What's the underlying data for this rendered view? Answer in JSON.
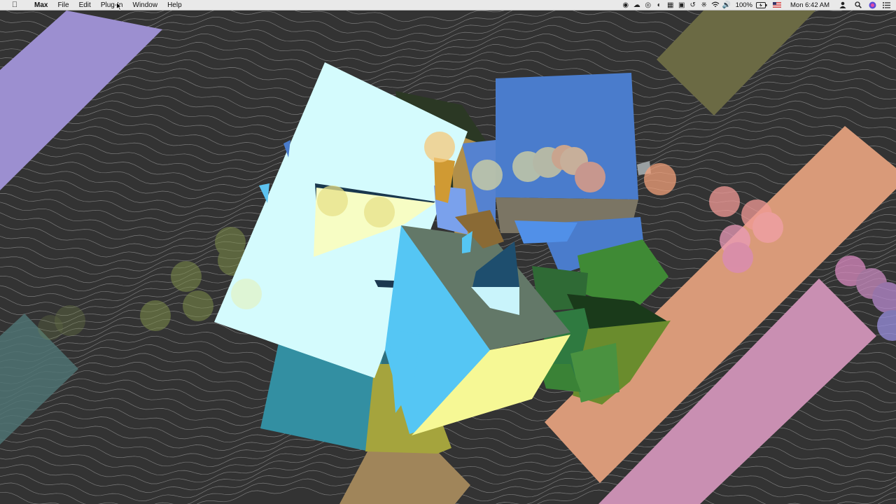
{
  "menubar": {
    "apple_icon": "apple-logo-icon",
    "app_name": "Max",
    "menus": [
      "File",
      "Edit",
      "Plug-In",
      "Window",
      "Help"
    ],
    "status_icons": [
      "record-icon",
      "cloud-icon",
      "cc-icon",
      "sync-icon",
      "grid-icon",
      "screen-icon",
      "time-machine-icon",
      "bluetooth-icon",
      "wifi-icon",
      "volume-icon"
    ],
    "battery_percent": "100%",
    "battery_icon": "battery-charging-icon",
    "input_source_icon": "us-flag-icon",
    "clock": "Mon 6:42 AM",
    "user_icon": "user-icon",
    "spotlight_icon": "search-icon",
    "siri_icon": "siri-icon",
    "notification_icon": "notification-center-icon"
  },
  "scene": {
    "description_colors": {
      "background": "#333333",
      "lavender_band": "#9c8fd0",
      "olive_band": "#6b6a44",
      "salmon_band": "#d99a79",
      "pink_band": "#c98fb2",
      "teal_band": "#4f7373",
      "tan_band": "#a0855a",
      "light_cube": "#d4fbfd",
      "blue_cube": "#4a7ccc",
      "sky_cube": "#55c6f4",
      "yellow_face": "#f6f895",
      "green_cube": "#3f8a35",
      "teal_cube": "#338fa2"
    }
  }
}
